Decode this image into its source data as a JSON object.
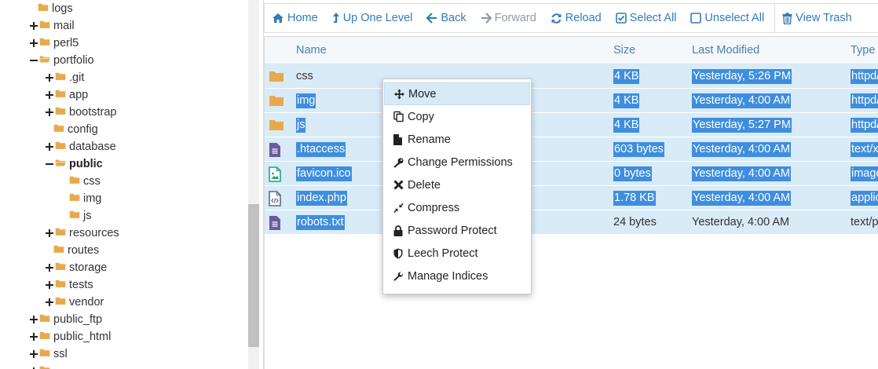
{
  "tree": {
    "items": [
      {
        "label": "logs",
        "toggle": "none",
        "open": false,
        "bold": false
      },
      {
        "label": "mail",
        "toggle": "plus",
        "open": false,
        "bold": false
      },
      {
        "label": "perl5",
        "toggle": "plus",
        "open": false,
        "bold": false
      },
      {
        "label": "portfolio",
        "toggle": "minus",
        "open": true,
        "bold": false
      },
      {
        "label": ".git",
        "toggle": "plus",
        "open": false,
        "bold": false
      },
      {
        "label": "app",
        "toggle": "plus",
        "open": false,
        "bold": false
      },
      {
        "label": "bootstrap",
        "toggle": "plus",
        "open": false,
        "bold": false
      },
      {
        "label": "config",
        "toggle": "none",
        "open": false,
        "bold": false
      },
      {
        "label": "database",
        "toggle": "plus",
        "open": false,
        "bold": false
      },
      {
        "label": "public",
        "toggle": "minus",
        "open": true,
        "bold": true
      },
      {
        "label": "css",
        "toggle": "none",
        "open": false,
        "bold": false
      },
      {
        "label": "img",
        "toggle": "none",
        "open": false,
        "bold": false
      },
      {
        "label": "js",
        "toggle": "none",
        "open": false,
        "bold": false
      },
      {
        "label": "resources",
        "toggle": "plus",
        "open": false,
        "bold": false
      },
      {
        "label": "routes",
        "toggle": "none",
        "open": false,
        "bold": false
      },
      {
        "label": "storage",
        "toggle": "plus",
        "open": false,
        "bold": false
      },
      {
        "label": "tests",
        "toggle": "plus",
        "open": false,
        "bold": false
      },
      {
        "label": "vendor",
        "toggle": "plus",
        "open": false,
        "bold": false
      },
      {
        "label": "public_ftp",
        "toggle": "plus",
        "open": false,
        "bold": false
      },
      {
        "label": "public_html",
        "toggle": "plus",
        "open": false,
        "bold": false
      },
      {
        "label": "ssl",
        "toggle": "plus",
        "open": false,
        "bold": false
      }
    ]
  },
  "toolbar": {
    "home": "Home",
    "up_one_level": "Up One Level",
    "back": "Back",
    "forward": "Forward",
    "reload": "Reload",
    "select_all": "Select All",
    "unselect_all": "Unselect All",
    "view_trash": "View Trash"
  },
  "table": {
    "headers": {
      "name": "Name",
      "size": "Size",
      "modified": "Last Modified",
      "type": "Type"
    },
    "rows": [
      {
        "icon": "folder-icon",
        "name": "css",
        "size": "4 KB",
        "modified": "Yesterday, 5:26 PM",
        "type": "httpd/",
        "name_highlighted": false,
        "size_highlighted": true
      },
      {
        "icon": "folder-icon",
        "name": "img",
        "size": "4 KB",
        "modified": "Yesterday, 4:00 AM",
        "type": "httpd/",
        "name_highlighted": true,
        "size_highlighted": true
      },
      {
        "icon": "folder-icon",
        "name": "js",
        "size": "4 KB",
        "modified": "Yesterday, 5:27 PM",
        "type": "httpd/",
        "name_highlighted": true,
        "size_highlighted": true
      },
      {
        "icon": "text-file-icon",
        "name": ".htaccess",
        "size": "603 bytes",
        "modified": "Yesterday, 4:00 AM",
        "type": "text/x-",
        "name_highlighted": true,
        "size_highlighted": true
      },
      {
        "icon": "image-file-icon",
        "name": "favicon.ico",
        "size": "0 bytes",
        "modified": "Yesterday, 4:00 AM",
        "type": "image",
        "name_highlighted": true,
        "size_highlighted": true
      },
      {
        "icon": "code-file-icon",
        "name": "index.php",
        "size": "1.78 KB",
        "modified": "Yesterday, 4:00 AM",
        "type": "applic",
        "name_highlighted": true,
        "size_highlighted": true
      },
      {
        "icon": "text-file-icon",
        "name": "robots.txt",
        "size": "24 bytes",
        "modified": "Yesterday, 4:00 AM",
        "type": "text/pl",
        "name_highlighted": true,
        "size_highlighted": false
      }
    ]
  },
  "context_menu": {
    "items": [
      {
        "label": "Move",
        "icon": "move-icon",
        "active": true
      },
      {
        "label": "Copy",
        "icon": "copy-icon",
        "active": false
      },
      {
        "label": "Rename",
        "icon": "file-icon",
        "active": false
      },
      {
        "label": "Change Permissions",
        "icon": "key-icon",
        "active": false
      },
      {
        "label": "Delete",
        "icon": "x-icon",
        "active": false
      },
      {
        "label": "Compress",
        "icon": "compress-icon",
        "active": false
      },
      {
        "label": "Password Protect",
        "icon": "lock-icon",
        "active": false
      },
      {
        "label": "Leech Protect",
        "icon": "shield-icon",
        "active": false
      },
      {
        "label": "Manage Indices",
        "icon": "wrench-icon",
        "active": false
      }
    ]
  },
  "colors": {
    "accent": "#337ab7",
    "row_selected": "#d9ebf7",
    "text_highlight": "#3f8ede",
    "folder": "#e8a94a",
    "disabled": "#8e9aa6"
  }
}
